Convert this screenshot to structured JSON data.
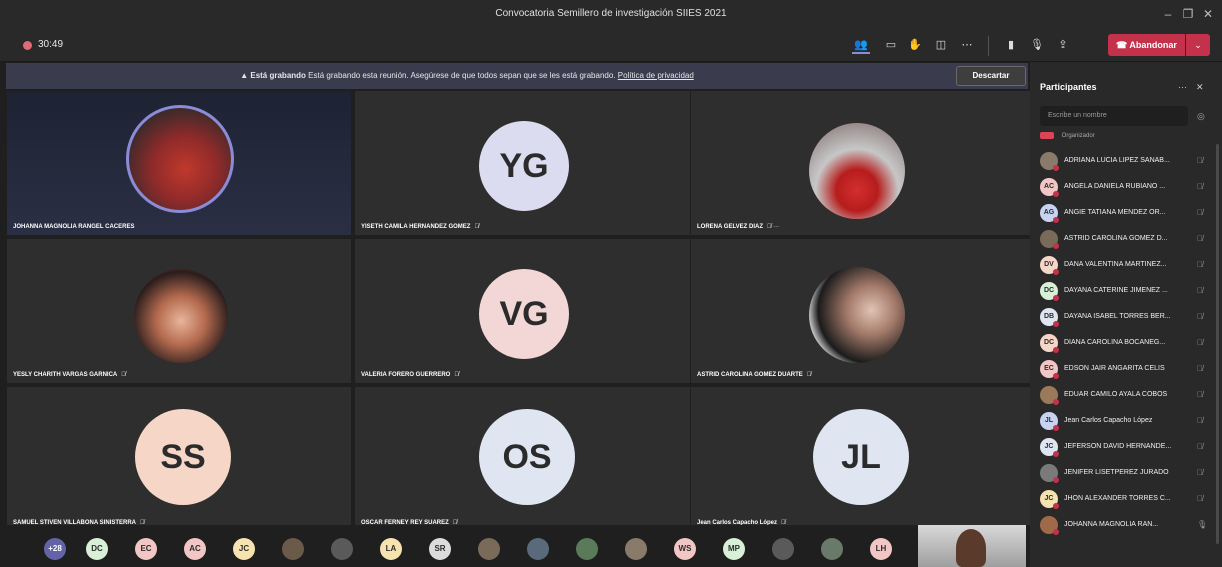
{
  "window": {
    "title": "Convocatoria Semillero de investigación SIIES 2021"
  },
  "toolbar": {
    "timer": "30:49",
    "leave_label": "Abandonar"
  },
  "banner": {
    "bold_text": "Está grabando",
    "message": "Está grabando esta reunión. Asegúrese de que todos sepan que se les está grabando.",
    "link": "Política de privacidad",
    "dismiss_label": "Descartar"
  },
  "tiles": [
    {
      "name": "JOHANNA MAGNOLIA RANGEL CACERES",
      "type": "photo"
    },
    {
      "name": "YISETH CAMILA HERNANDEZ GOMEZ",
      "type": "initials",
      "initials": "YG",
      "color": "#dcdcf0"
    },
    {
      "name": "LORENA GELVEZ DIAZ",
      "type": "photo"
    },
    {
      "name": "YESLY CHARITH VARGAS GARNICA",
      "type": "photo"
    },
    {
      "name": "VALERIA FORERO GUERRERO",
      "type": "initials",
      "initials": "VG",
      "color": "#f3d6d6"
    },
    {
      "name": "ASTRID CAROLINA GOMEZ DUARTE",
      "type": "photo"
    },
    {
      "name": "SAMUEL STIVEN VILLABONA SINISTERRA",
      "type": "initials",
      "initials": "SS",
      "color": "#f6d7c7"
    },
    {
      "name": "OSCAR FERNEY REY SUAREZ",
      "type": "initials",
      "initials": "OS",
      "color": "#dfe6f1"
    },
    {
      "name": "Jean Carlos Capacho López",
      "type": "initials",
      "initials": "JL",
      "color": "#dfe6f1"
    }
  ],
  "panel": {
    "title": "Participantes",
    "search_placeholder": "Escribe un nombre",
    "organizer_label": "Organizador",
    "participants": [
      {
        "initials": "",
        "name": "ADRIANA LUCIA LIPEZ SANAB...",
        "color": "#8a7a6a"
      },
      {
        "initials": "AC",
        "name": "ANGELA DANIELA RUBIANO ...",
        "color": "#f3c6c6"
      },
      {
        "initials": "AG",
        "name": "ANGIE TATIANA MENDEZ OR...",
        "color": "#c7d3f0"
      },
      {
        "initials": "",
        "name": "ASTRID CAROLINA GOMEZ D...",
        "color": "#7a6a5a"
      },
      {
        "initials": "DV",
        "name": "DANA VALENTINA MARTINEZ...",
        "color": "#f6d7c7"
      },
      {
        "initials": "DC",
        "name": "DAYANA CATERINE JIMENEZ ...",
        "color": "#d7f0d7"
      },
      {
        "initials": "DB",
        "name": "DAYANA ISABEL TORRES BER...",
        "color": "#dfe6f1"
      },
      {
        "initials": "DC",
        "name": "DIANA CAROLINA BOCANEG...",
        "color": "#f6d7c7"
      },
      {
        "initials": "EC",
        "name": "EDSON JAIR ANGARITA CELIS",
        "color": "#f3c6c6"
      },
      {
        "initials": "",
        "name": "EDUAR CAMILO AYALA COBOS",
        "color": "#9a7a5a"
      },
      {
        "initials": "JL",
        "name": "Jean Carlos Capacho López",
        "color": "#c7d3f0"
      },
      {
        "initials": "JC",
        "name": "JEFERSON DAVID HERNANDE...",
        "color": "#dfe6f1"
      },
      {
        "initials": "",
        "name": "JENIFER LISETPEREZ JURADO",
        "color": "#7a7a7a"
      },
      {
        "initials": "JC",
        "name": "JHON ALEXANDER TORRES C...",
        "color": "#f6e3b0"
      },
      {
        "initials": "",
        "name": "JOHANNA MAGNOLIA RAN...",
        "color": "#a06a4a"
      }
    ]
  },
  "strip": {
    "overflow_count": "+28",
    "avatars": [
      {
        "initials": "DC",
        "color": "#d7f0d7"
      },
      {
        "initials": "EC",
        "color": "#f3c6c6"
      },
      {
        "initials": "AC",
        "color": "#f3c6c6"
      },
      {
        "initials": "JC",
        "color": "#f6e3b0"
      },
      {
        "initials": "",
        "color": "#6a5a4a"
      },
      {
        "initials": "",
        "color": "#5a5a5a"
      },
      {
        "initials": "LA",
        "color": "#f6e3b0"
      },
      {
        "initials": "SR",
        "color": "#dcdcdc"
      },
      {
        "initials": "",
        "color": "#7a6a5a"
      },
      {
        "initials": "",
        "color": "#5a6a7a"
      },
      {
        "initials": "",
        "color": "#5a7a5a"
      },
      {
        "initials": "",
        "color": "#8a7a6a"
      },
      {
        "initials": "WS",
        "color": "#f3c6c6"
      },
      {
        "initials": "MP",
        "color": "#d7f0d7"
      },
      {
        "initials": "",
        "color": "#5a5a5a"
      },
      {
        "initials": "",
        "color": "#6a7a6a"
      },
      {
        "initials": "LH",
        "color": "#f3c6c6"
      }
    ]
  }
}
